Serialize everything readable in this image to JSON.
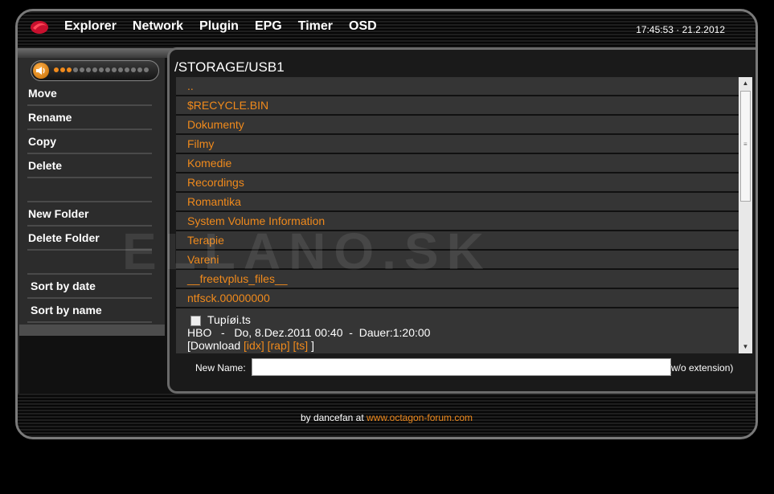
{
  "nav": {
    "items": [
      "Explorer",
      "Network",
      "Plugin",
      "EPG",
      "Timer",
      "OSD"
    ],
    "clock": "17:45:53 · 21.2.2012"
  },
  "volume": {
    "level": 0.2,
    "segments": 15
  },
  "sidebar": {
    "items": [
      "Move",
      "Rename",
      "Copy",
      "Delete",
      "",
      "New Folder",
      "Delete Folder",
      "",
      "Sort by date",
      "Sort by name"
    ]
  },
  "main": {
    "path": "/STORAGE/USB1",
    "folders": [
      "..",
      "$RECYCLE.BIN",
      "Dokumenty",
      "Filmy",
      "Komedie",
      "Recordings",
      "Romantika",
      "System Volume Information",
      "Terapie",
      "Vareni",
      "__freetvplus_files__",
      "ntfsck.00000000"
    ],
    "file": {
      "name": "Tupíøi.ts",
      "info": "HBO   -   Do, 8.Dez.2011 00:40  -  Dauer:1:20:00",
      "download_label": "[Download",
      "links": [
        "[idx]",
        "[rap]",
        "[ts]"
      ],
      "close": "]"
    },
    "rename": {
      "label": "New Name:",
      "value": "",
      "hint": "(w/o extension)"
    }
  },
  "footer": {
    "by_text": "by dancefan at ",
    "link_text": "www.octagon-forum.com"
  },
  "watermark": "ELLANO.SK",
  "colors": {
    "accent": "#f08a1c",
    "background": "#000000",
    "panel": "#303030"
  }
}
